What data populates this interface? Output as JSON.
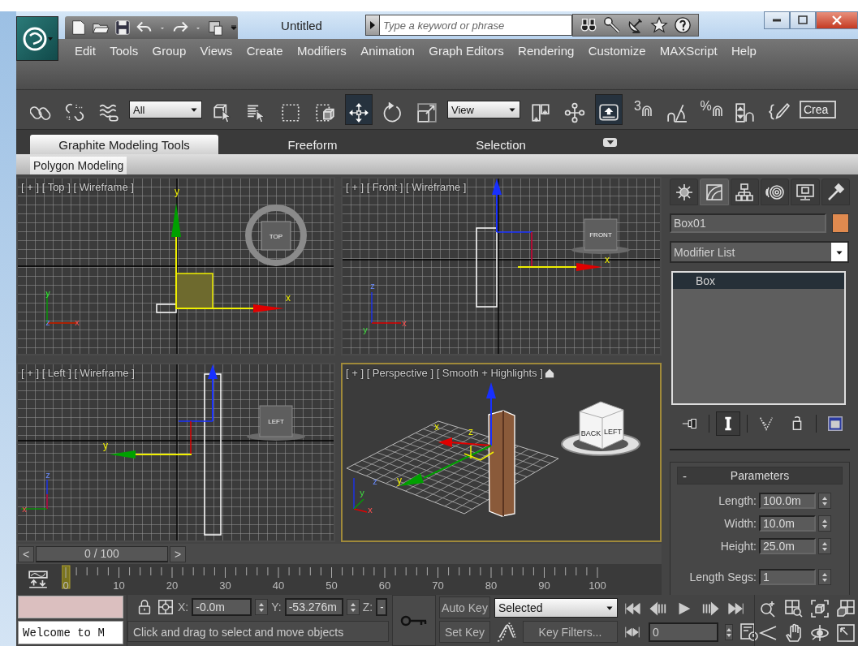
{
  "title_bar": {
    "title": "Untitled",
    "search_placeholder": "Type a keyword or phrase"
  },
  "menu": [
    "Edit",
    "Tools",
    "Group",
    "Views",
    "Create",
    "Modifiers",
    "Animation",
    "Graph Editors",
    "Rendering",
    "Customize",
    "MAXScript",
    "Help"
  ],
  "main_toolbar": [
    {
      "kind": "button",
      "selected": false
    },
    {
      "kind": "button",
      "selected": false
    },
    {
      "kind": "button",
      "selected": false
    },
    {
      "kind": "dropdown",
      "value": "All"
    },
    {
      "kind": "button",
      "selected": false
    },
    {
      "kind": "button",
      "selected": false
    },
    {
      "kind": "button",
      "selected": false
    },
    {
      "kind": "button",
      "selected": false
    },
    {
      "kind": "button",
      "selected": true
    },
    {
      "kind": "button",
      "selected": false
    },
    {
      "kind": "button",
      "selected": false
    },
    {
      "kind": "dropdown",
      "value": "View"
    },
    {
      "kind": "button",
      "selected": false
    },
    {
      "kind": "button",
      "selected": false
    },
    {
      "kind": "button",
      "selected": true
    },
    {
      "kind": "button",
      "selected": false,
      "label": "3"
    },
    {
      "kind": "button",
      "selected": false
    },
    {
      "kind": "button",
      "selected": false,
      "label": "%"
    },
    {
      "kind": "button",
      "selected": false
    },
    {
      "kind": "button",
      "selected": false
    },
    {
      "kind": "field",
      "value": "Crea"
    }
  ],
  "ribbon": {
    "tabs": [
      {
        "label": "Graphite Modeling Tools",
        "selected": true
      },
      {
        "label": "Freeform",
        "selected": false
      },
      {
        "label": "Selection",
        "selected": false
      }
    ],
    "panel": "Polygon Modeling"
  },
  "viewports": [
    {
      "label": "[ + ] [ Top ] [ Wireframe ]",
      "active": false,
      "cube_labels": [
        "TOP"
      ],
      "gizmo_labels": [
        "y",
        "x"
      ],
      "tripod_labels": [
        "y",
        "z",
        "x"
      ]
    },
    {
      "label": "[ + ] [ Front ] [ Wireframe ]",
      "active": false,
      "cube_labels": [
        "FRONT"
      ],
      "gizmo_labels": [
        "x"
      ],
      "tripod_labels": [
        "z",
        "y",
        "x"
      ]
    },
    {
      "label": "[ + ] [ Left ] [ Wireframe ]",
      "active": false,
      "cube_labels": [
        "LEFT"
      ],
      "gizmo_labels": [
        "y"
      ],
      "tripod_labels": [
        "z",
        "x"
      ]
    },
    {
      "label": "[ + ] [ Perspective ] [ Smooth + Highlights ]",
      "active": true,
      "cube_labels": [
        "BACK",
        "LEFT"
      ],
      "gizmo_labels": [
        "x",
        "z",
        "y"
      ],
      "tripod_labels": [
        "z",
        "y",
        "x"
      ]
    }
  ],
  "command_panel": {
    "tabs": [
      {
        "selected": false
      },
      {
        "selected": true
      },
      {
        "selected": false
      },
      {
        "selected": false
      },
      {
        "selected": false
      },
      {
        "selected": false
      }
    ],
    "object": {
      "name": "Box01",
      "color": "#e08a4f"
    },
    "modifier_list": "Modifier List",
    "stack": [
      {
        "label": "Box",
        "selected": true
      }
    ],
    "stack_buttons": [
      {
        "selected": false
      },
      {
        "selected": true
      },
      {
        "selected": false
      },
      {
        "selected": false
      },
      {
        "selected": false
      }
    ],
    "rollout": {
      "collapse": "-",
      "title": "Parameters",
      "fields": [
        {
          "label": "Length:",
          "value": "100.0m"
        },
        {
          "label": "Width:",
          "value": "10.0m"
        },
        {
          "label": "Height:",
          "value": "25.0m"
        },
        {
          "label": "Length Segs:",
          "value": "1"
        }
      ]
    }
  },
  "time_slider": {
    "prev": "<",
    "position": "0 / 100",
    "next": ">"
  },
  "track_bar": {
    "ticks": [
      "0",
      "10",
      "20",
      "30",
      "40",
      "50",
      "60",
      "70",
      "80",
      "90",
      "100"
    ]
  },
  "status_bar": {
    "listener": "Welcome to M",
    "coords": [
      {
        "label": "X:",
        "value": "-0.0m"
      },
      {
        "label": "Y:",
        "value": "-53.276m"
      },
      {
        "label": "Z:",
        "value": "-"
      }
    ],
    "prompt": "Click and drag to select and move objects",
    "auto_key": "Auto Key",
    "set_key": "Set Key",
    "key_mode": "Selected",
    "key_filters": "Key Filters...",
    "frame": "0"
  }
}
